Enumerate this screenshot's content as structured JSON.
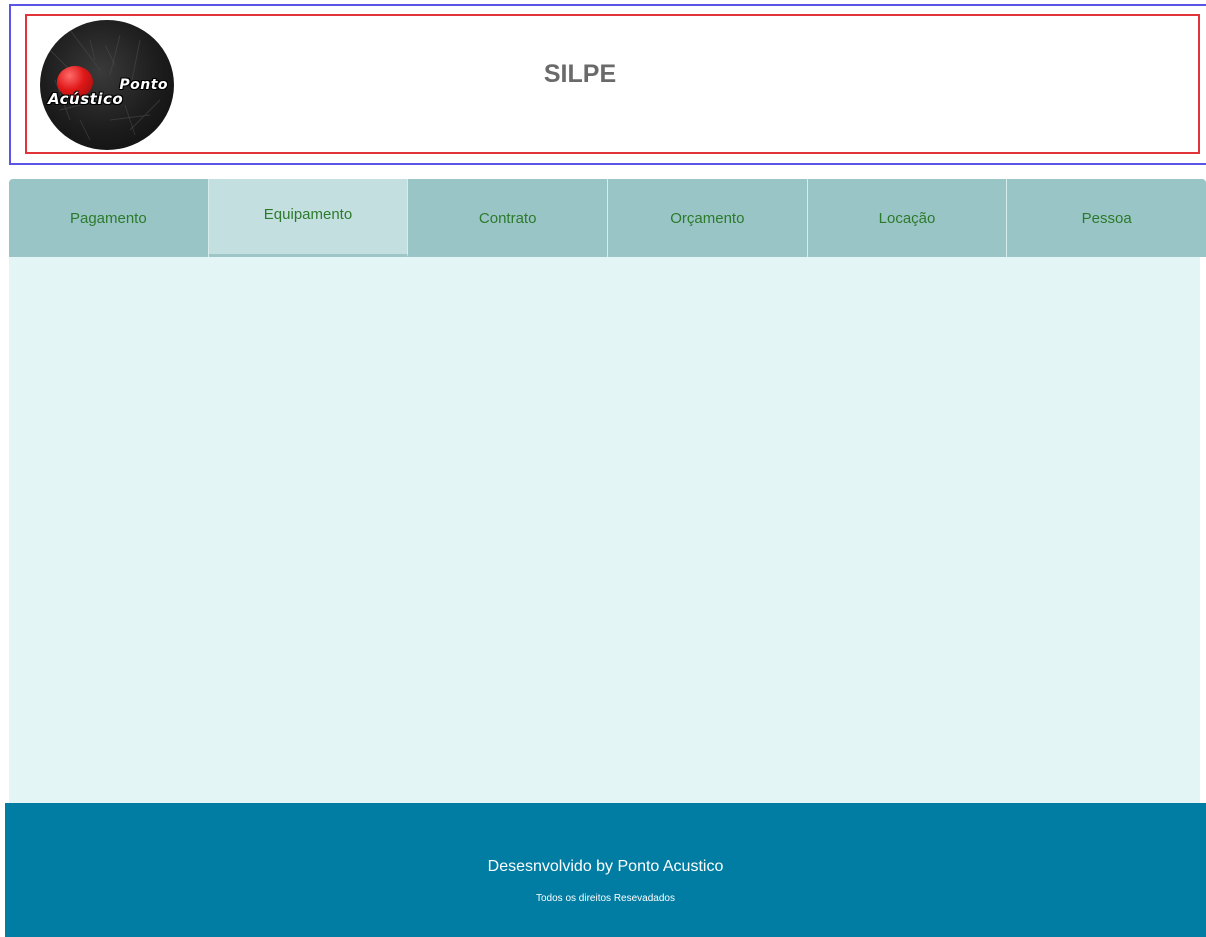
{
  "header": {
    "logo_text_line1": "Ponto",
    "logo_text_line2": "Acústico",
    "title": "SILPE"
  },
  "tabs": [
    {
      "label": "Pagamento",
      "active": false
    },
    {
      "label": "Equipamento",
      "active": true
    },
    {
      "label": "Contrato",
      "active": false
    },
    {
      "label": "Orçamento",
      "active": false
    },
    {
      "label": "Locação",
      "active": false
    },
    {
      "label": "Pessoa",
      "active": false
    }
  ],
  "footer": {
    "credit": "Desesnvolvido by Ponto Acustico",
    "rights": "Todos os direitos Resevadados"
  },
  "colors": {
    "header_outer_border": "#5b55e6",
    "header_inner_border": "#e0333a",
    "tab_bar": "#99c5c6",
    "tab_active": "#c4dfe0",
    "tab_text": "#2c7a2c",
    "content_bg": "#e3f5f5",
    "footer_bg": "#017da3"
  }
}
